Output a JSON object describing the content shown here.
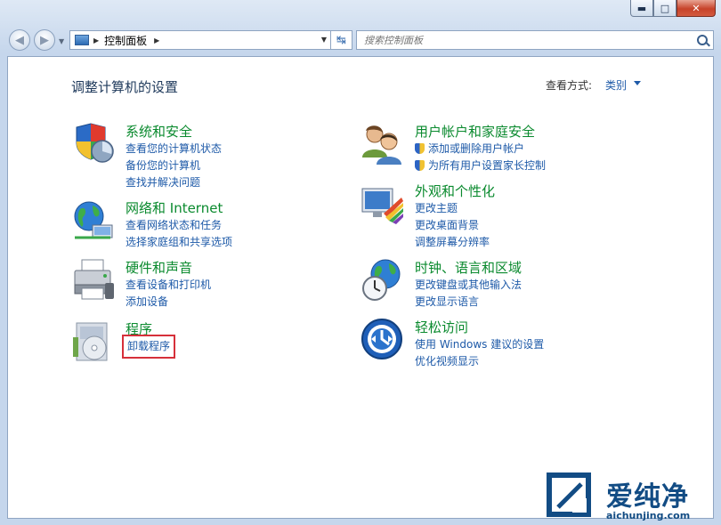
{
  "window": {
    "caption_buttons": {
      "minimize": "▬",
      "maximize": "□",
      "close": "✕"
    }
  },
  "address_bar": {
    "path": "控制面板",
    "refresh_glyph": "↹"
  },
  "search": {
    "placeholder": "搜索控制面板"
  },
  "main": {
    "heading": "调整计算机的设置",
    "view_by_label": "查看方式:",
    "view_by_value": "类别"
  },
  "categories": [
    {
      "title": "系统和安全",
      "icon": "shield-computer-icon",
      "links": [
        "查看您的计算机状态",
        "备份您的计算机",
        "查找并解决问题"
      ]
    },
    {
      "title": "网络和 Internet",
      "icon": "network-globe-icon",
      "links": [
        "查看网络状态和任务",
        "选择家庭组和共享选项"
      ]
    },
    {
      "title": "硬件和声音",
      "icon": "printer-icon",
      "links": [
        "查看设备和打印机",
        "添加设备"
      ]
    },
    {
      "title": "程序",
      "icon": "programs-disc-icon",
      "links": [
        "卸载程序"
      ]
    },
    {
      "title": "用户帐户和家庭安全",
      "icon": "users-icon",
      "links": [
        "添加或删除用户帐户",
        "为所有用户设置家长控制"
      ]
    },
    {
      "title": "外观和个性化",
      "icon": "monitor-paint-icon",
      "links": [
        "更改主题",
        "更改桌面背景",
        "调整屏幕分辨率"
      ]
    },
    {
      "title": "时钟、语言和区域",
      "icon": "clock-globe-icon",
      "links": [
        "更改键盘或其他输入法",
        "更改显示语言"
      ]
    },
    {
      "title": "轻松访问",
      "icon": "ease-of-access-icon",
      "links": [
        "使用 Windows 建议的设置",
        "优化视频显示"
      ]
    }
  ],
  "watermark": {
    "name": "爱纯净",
    "url": "aichunjing.com"
  },
  "colors": {
    "category_title": "#0a8a2e",
    "link": "#1e5aa8",
    "highlight_box": "#d6303a"
  }
}
